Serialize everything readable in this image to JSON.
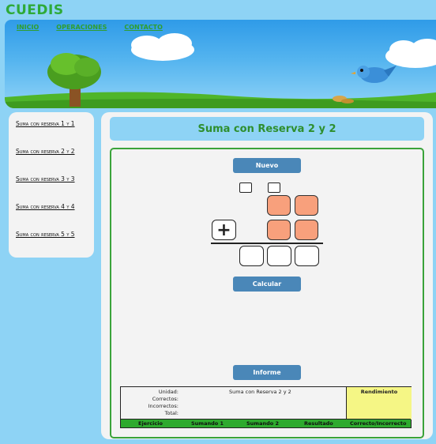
{
  "site": {
    "brand": "CUEDIS"
  },
  "nav": {
    "items": [
      "INICIO",
      "OPERACIONES",
      "CONTACTO"
    ]
  },
  "sidebar": {
    "items": [
      "Suma con reserva 1 y 1",
      "Suma con reserva 2 y 2",
      "Suma con reserva 3 y 3",
      "Suma con reserva 4 y 4",
      "Suma con reserva 5 y 5"
    ]
  },
  "main": {
    "title": "Suma con Reserva 2 y 2",
    "buttons": {
      "nuevo": "Nuevo",
      "calcular": "Calcular",
      "informe": "Informe"
    },
    "operator": "+"
  },
  "report": {
    "labels": {
      "unidad": "Unidad:",
      "correctos": "Correctos:",
      "incorrectos": "Incorrectos:",
      "total": "Total:"
    },
    "unidad_value": "Suma con Reserva 2 y 2",
    "rendimiento": "Rendimiento",
    "columns": [
      "Ejercicio",
      "Sumando 1",
      "Sumando 2",
      "Resultado",
      "Correcto/Incorrecto"
    ]
  },
  "colors": {
    "page_bg": "#8ed3f5",
    "brand": "#2eaa38",
    "button": "#4a87b8",
    "digit_tile": "#f8a07c",
    "panel_border": "#3aa33a",
    "rendimiento_bg": "#f5f685",
    "report_header_bg": "#2eaa2e"
  }
}
